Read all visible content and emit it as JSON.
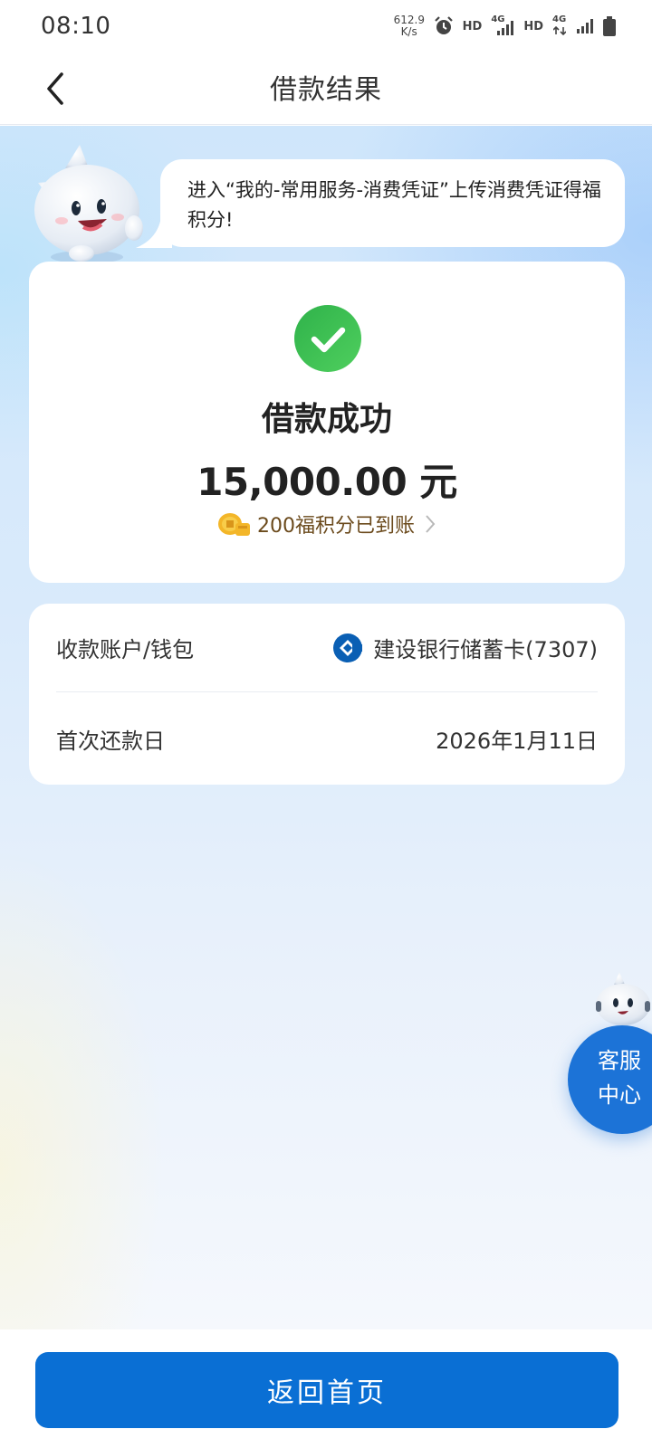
{
  "status_bar": {
    "time": "08:10",
    "net_speed_value": "612.9",
    "net_speed_unit": "K/s",
    "hd_1": "HD",
    "hd_2": "HD",
    "network_1": "4G",
    "network_2": "4G",
    "icons": [
      "alarm-icon",
      "signal-icon",
      "signal-icon",
      "battery-icon"
    ]
  },
  "nav": {
    "title": "借款结果",
    "back_icon": "chevron-left-icon"
  },
  "tip": {
    "text": "进入“我的-常用服务-消费凭证”上传消费凭证得福积分!"
  },
  "result": {
    "icon": "check-circle-icon",
    "title": "借款成功",
    "amount": "15,000.00 元",
    "points_text": "200福积分已到账",
    "colors": {
      "success": "#3cc04f",
      "points": "#6b4a1c"
    }
  },
  "details": {
    "account_label": "收款账户/钱包",
    "account_value": "建设银行储蓄卡(7307)",
    "first_repay_label": "首次还款日",
    "first_repay_value": "2026年1月11日"
  },
  "service": {
    "line1": "客服",
    "line2": "中心"
  },
  "footer": {
    "home_button": "返回首页",
    "accent": "#0a6fd4"
  }
}
